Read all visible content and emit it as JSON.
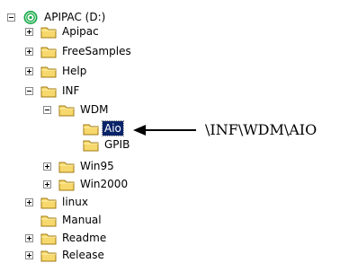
{
  "tree": {
    "root_label": "APIPAC (D:)",
    "items": [
      {
        "label": "Apipac"
      },
      {
        "label": "FreeSamples"
      },
      {
        "label": "Help"
      },
      {
        "label": "INF"
      },
      {
        "label": "WDM"
      },
      {
        "label": "Aio"
      },
      {
        "label": "GPIB"
      },
      {
        "label": "Win95"
      },
      {
        "label": "Win2000"
      },
      {
        "label": "linux"
      },
      {
        "label": "Manual"
      },
      {
        "label": "Readme"
      },
      {
        "label": "Release"
      }
    ]
  },
  "annotation": {
    "text": "\\INF\\WDM\\AIO"
  },
  "colors": {
    "folder_fill": "#f7d86c",
    "folder_stroke": "#a07a12",
    "selection": "#0a246a",
    "drive_ring": "#1aa84a"
  }
}
